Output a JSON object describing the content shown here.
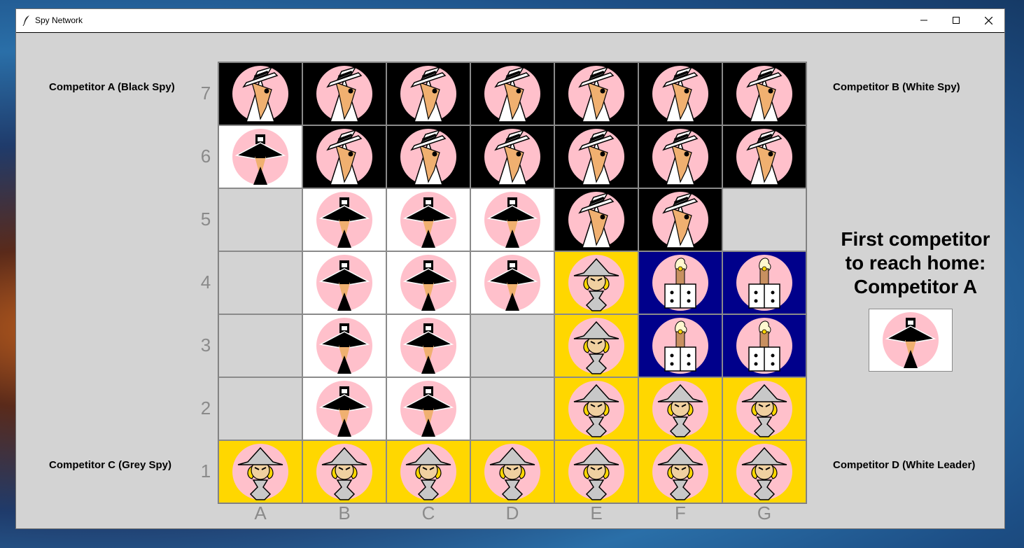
{
  "window": {
    "title": "Spy Network"
  },
  "labels": {
    "competitor_a": "Competitor A (Black Spy)",
    "competitor_b": "Competitor B (White Spy)",
    "competitor_c": "Competitor C (Grey Spy)",
    "competitor_d": "Competitor D (White Leader)"
  },
  "winner": {
    "line1": "First competitor",
    "line2": "to reach home:",
    "line3": "Competitor A",
    "piece": "black"
  },
  "board": {
    "rows": [
      "7",
      "6",
      "5",
      "4",
      "3",
      "2",
      "1"
    ],
    "columns": [
      "A",
      "B",
      "C",
      "D",
      "E",
      "F",
      "G"
    ],
    "cells": [
      [
        "white",
        "white",
        "white",
        "white",
        "white",
        "white",
        "white"
      ],
      [
        "black",
        "white",
        "white",
        "white",
        "white",
        "white",
        "white"
      ],
      [
        "",
        "black",
        "black",
        "black",
        "white",
        "white",
        ""
      ],
      [
        "",
        "black",
        "black",
        "black",
        "grey",
        "leader",
        "leader"
      ],
      [
        "",
        "black",
        "black",
        "",
        "grey",
        "leader",
        "leader"
      ],
      [
        "",
        "black",
        "black",
        "",
        "grey",
        "grey",
        "grey"
      ],
      [
        "grey",
        "grey",
        "grey",
        "grey",
        "grey",
        "grey",
        "grey"
      ]
    ]
  },
  "colors": {
    "white_spy_bg": "#000000",
    "black_spy_bg": "#ffffff",
    "grey_spy_bg": "#ffd700",
    "leader_bg": "#00008b",
    "empty_bg": "#d3d3d3",
    "face_circle": "#ffc0cb"
  },
  "icons": {
    "white_spy": "white-spy-icon",
    "black_spy": "black-spy-icon",
    "grey_spy": "grey-spy-icon",
    "leader": "white-leader-icon"
  }
}
